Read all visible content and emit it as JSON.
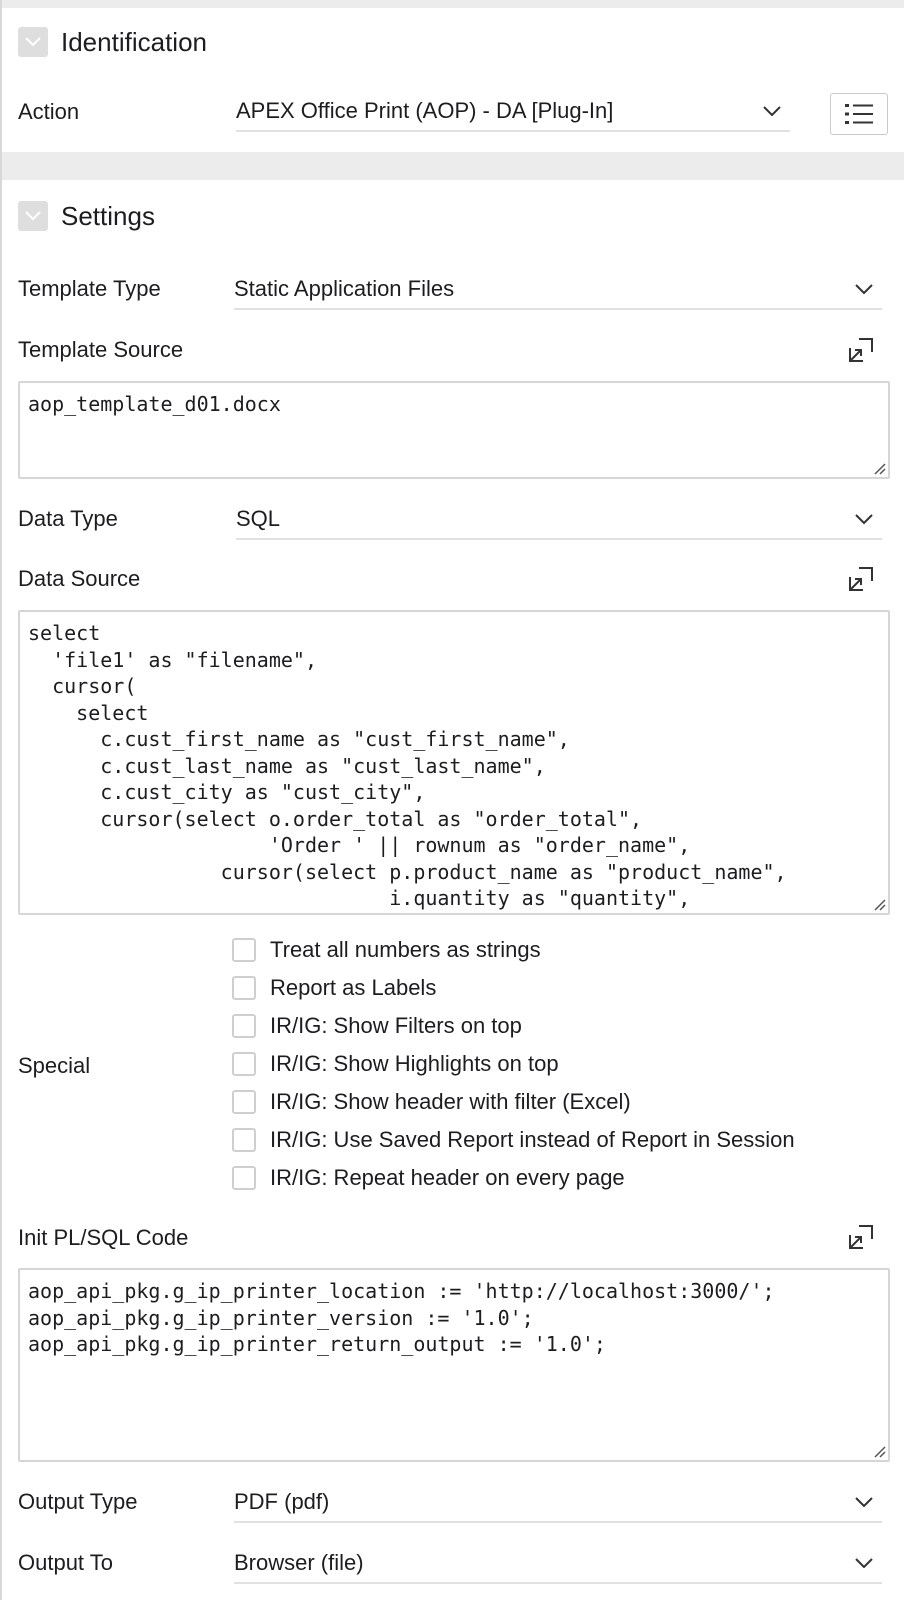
{
  "identification": {
    "title": "Identification",
    "action_label": "Action",
    "action_value": "APEX Office Print (AOP) - DA [Plug-In]"
  },
  "settings": {
    "title": "Settings",
    "template_type_label": "Template Type",
    "template_type_value": "Static Application Files",
    "template_source_label": "Template Source",
    "template_source_value": "aop_template_d01.docx",
    "data_type_label": "Data Type",
    "data_type_value": "SQL",
    "data_source_label": "Data Source",
    "data_source_value": "select\n  'file1' as \"filename\",\n  cursor(\n    select\n      c.cust_first_name as \"cust_first_name\",\n      c.cust_last_name as \"cust_last_name\",\n      c.cust_city as \"cust_city\",\n      cursor(select o.order_total as \"order_total\",\n                    'Order ' || rownum as \"order_name\",\n                cursor(select p.product_name as \"product_name\",\n                              i.quantity as \"quantity\",",
    "special_label": "Special",
    "special_options": [
      "Treat all numbers as strings",
      "Report as Labels",
      "IR/IG: Show Filters on top",
      "IR/IG: Show Highlights on top",
      "IR/IG: Show header with filter (Excel)",
      "IR/IG: Use Saved Report instead of Report in Session",
      "IR/IG: Repeat header on every page"
    ],
    "init_code_label": "Init PL/SQL Code",
    "init_code_value": "aop_api_pkg.g_ip_printer_location := 'http://localhost:3000/';\naop_api_pkg.g_ip_printer_version := '1.0';\naop_api_pkg.g_ip_printer_return_output := '1.0';",
    "output_type_label": "Output Type",
    "output_type_value": "PDF (pdf)",
    "output_to_label": "Output To",
    "output_to_value": "Browser (file)"
  },
  "icons": {
    "section_toggle": "chevron-down-icon",
    "select_arrow": "chevron-down-icon",
    "list_button": "list-icon",
    "expand_editor": "expand-editor-icon",
    "resize": "resize-grip-icon"
  },
  "colors": {
    "text": "#1d1d1f",
    "separator": "#ececec",
    "toggle_bg": "#dedede",
    "border": "#d6d6d6"
  }
}
